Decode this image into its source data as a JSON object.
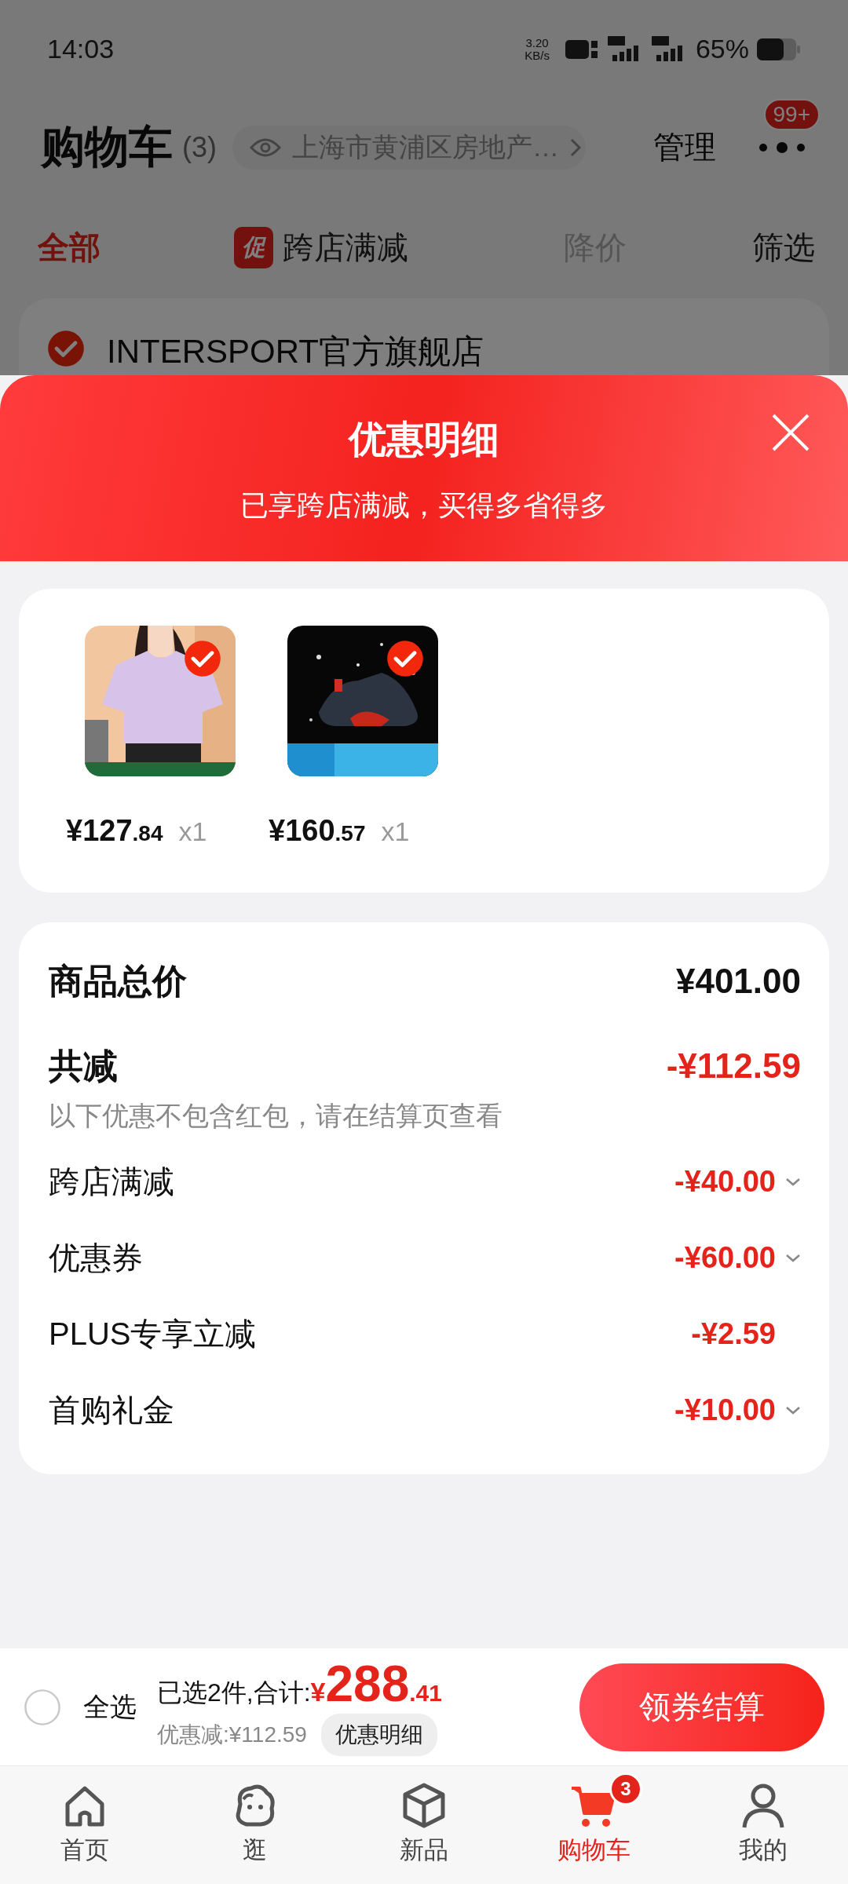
{
  "status_bar": {
    "time": "14:03",
    "net_speed": "3.20",
    "net_unit": "KB/s",
    "battery": "65%"
  },
  "header": {
    "title": "购物车",
    "count": "(3)",
    "location": "上海市黄浦区房地产…",
    "manage": "管理",
    "badge": "99+"
  },
  "filter_tabs": [
    {
      "label": "全部",
      "selected": true,
      "disabled": false
    },
    {
      "label": "跨店满减",
      "selected": false,
      "disabled": false,
      "promo": "促"
    },
    {
      "label": "降价",
      "selected": false,
      "disabled": true
    },
    {
      "label": "筛选",
      "selected": false,
      "disabled": false
    }
  ],
  "store": {
    "name": "INTERSPORT官方旗舰店",
    "checked": true
  },
  "sheet": {
    "title": "优惠明细",
    "subtitle": "已享跨店满减，买得多省得多"
  },
  "items": [
    {
      "kind": "shirt",
      "checked": true,
      "price": "¥127",
      "cents": ".84",
      "qty": "x1"
    },
    {
      "kind": "shoe",
      "checked": true,
      "price": "¥160",
      "cents": ".57",
      "qty": "x1"
    }
  ],
  "summary": {
    "total_label": "商品总价",
    "total_value": "¥401.00",
    "discount_label": "共减",
    "discount_value": "-¥112.59",
    "note": "以下优惠不包含红包，请在结算页查看",
    "rows": [
      {
        "label": "跨店满减",
        "value": "-¥40.00",
        "expandable": true
      },
      {
        "label": "优惠券",
        "value": "-¥60.00",
        "expandable": true
      },
      {
        "label": "PLUS专享立减",
        "value": "-¥2.59",
        "expandable": false
      },
      {
        "label": "首购礼金",
        "value": "-¥10.00",
        "expandable": true
      }
    ]
  },
  "footer": {
    "select_all": {
      "label": "全选",
      "checked": false
    },
    "selected_text": "已选2件,合计:",
    "currency": "¥",
    "amount": "288",
    "cents": ".41",
    "saved": "优惠减:¥112.59",
    "detail_button": "优惠明细",
    "checkout": "领券结算"
  },
  "nav": [
    {
      "kind": "home",
      "label": "首页",
      "selected": false
    },
    {
      "kind": "blob",
      "label": "逛",
      "selected": false
    },
    {
      "kind": "cube",
      "label": "新品",
      "selected": false
    },
    {
      "kind": "cart",
      "label": "购物车",
      "selected": true,
      "badge": "3"
    },
    {
      "kind": "person",
      "label": "我的",
      "selected": false
    }
  ]
}
